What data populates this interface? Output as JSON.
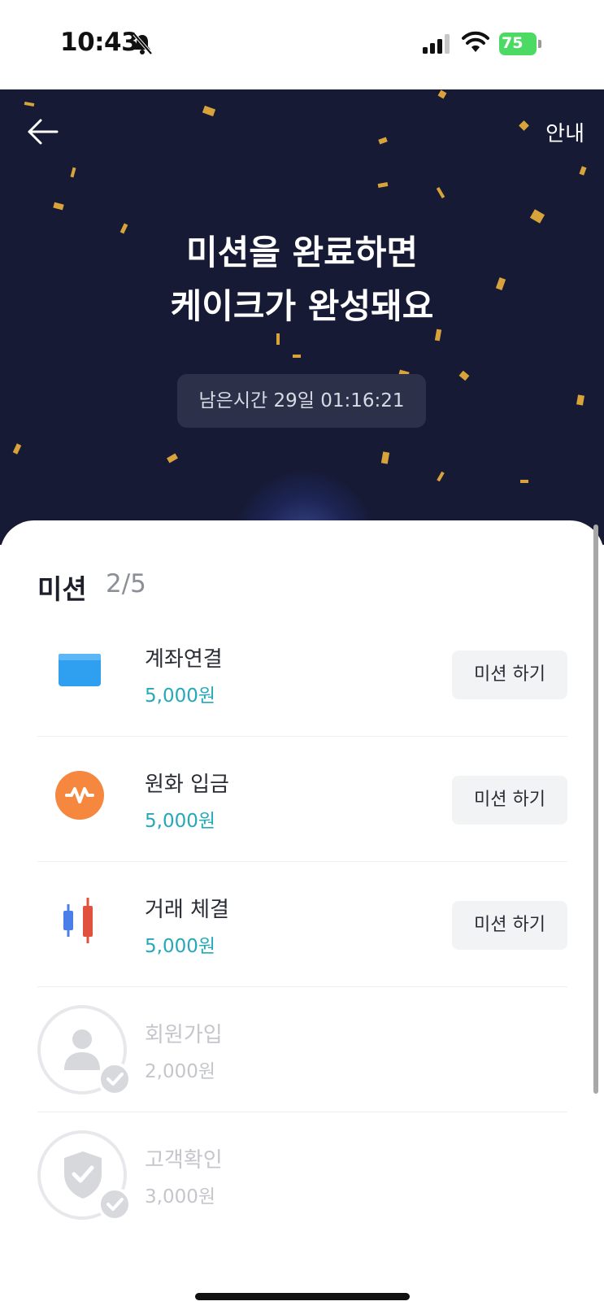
{
  "status_bar": {
    "time": "10:43",
    "battery": "75",
    "icons": [
      "bell-slash-icon",
      "signal-icon",
      "wifi-icon",
      "battery-icon"
    ]
  },
  "header": {
    "back_icon": "arrow-left-icon",
    "guide_label": "안내"
  },
  "hero": {
    "title_line1": "미션을 완료하면",
    "title_line2": "케이크가 완성돼요",
    "remaining_time": "남은시간 29일 01:16:21",
    "background_color": "#161a35",
    "confetti_color": "#d8a33a"
  },
  "missions_section": {
    "title": "미션",
    "progress": "2/5",
    "items": [
      {
        "name": "계좌연결",
        "reward": "5,000원",
        "action": "미션 하기",
        "icon": "card-icon",
        "completed": false
      },
      {
        "name": "원화 입금",
        "reward": "5,000원",
        "action": "미션 하기",
        "icon": "won-coin-icon",
        "completed": false
      },
      {
        "name": "거래 체결",
        "reward": "5,000원",
        "action": "미션 하기",
        "icon": "candlestick-icon",
        "completed": false
      },
      {
        "name": "회원가입",
        "reward": "2,000원",
        "icon": "user-icon",
        "completed": true
      },
      {
        "name": "고객확인",
        "reward": "3,000원",
        "icon": "shield-check-icon",
        "completed": true
      }
    ],
    "reward_color": "#25a8b8"
  }
}
